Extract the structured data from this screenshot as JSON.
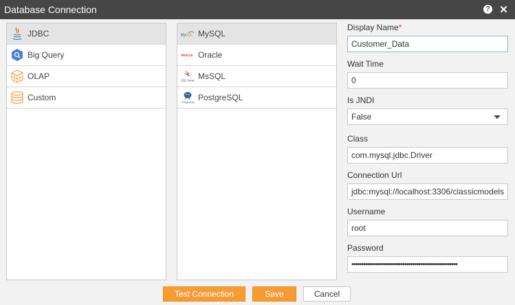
{
  "window": {
    "title": "Database Connection",
    "help_icon": "help-icon",
    "close_icon": "close-icon"
  },
  "connection_types": [
    {
      "label": "JDBC",
      "icon": "java-icon",
      "selected": true
    },
    {
      "label": "Big Query",
      "icon": "bigquery-icon",
      "selected": false
    },
    {
      "label": "OLAP",
      "icon": "cube-icon",
      "selected": false
    },
    {
      "label": "Custom",
      "icon": "database-icon",
      "selected": false
    }
  ],
  "drivers": [
    {
      "label": "MySQL",
      "icon": "mysql-icon",
      "selected": true
    },
    {
      "label": "Oracle",
      "icon": "oracle-icon",
      "selected": false
    },
    {
      "label": "MsSQL",
      "icon": "sqlserver-icon",
      "selected": false
    },
    {
      "label": "PostgreSQL",
      "icon": "postgresql-icon",
      "selected": false
    }
  ],
  "form": {
    "display_name": {
      "label": "Display Name",
      "required_mark": "*",
      "value": "Customer_Data"
    },
    "wait_time": {
      "label": "Wait Time",
      "value": "0"
    },
    "is_jndi": {
      "label": "Is JNDI",
      "value": "False"
    },
    "class": {
      "label": "Class",
      "value": "com.mysql.jdbc.Driver"
    },
    "connection_url": {
      "label": "Connection Url",
      "value": "jdbc:mysql://localhost:3306/classicmodels"
    },
    "username": {
      "label": "Username",
      "value": "root"
    },
    "password": {
      "label": "Password",
      "value": "••••••••••••••••••••••••••••••••••••••••••••••••••••••"
    }
  },
  "buttons": {
    "test_connection": "Test Connection",
    "save": "Save",
    "cancel": "Cancel"
  },
  "colors": {
    "titlebar": "#464646",
    "accent": "#f79c34",
    "required": "#e53935"
  }
}
